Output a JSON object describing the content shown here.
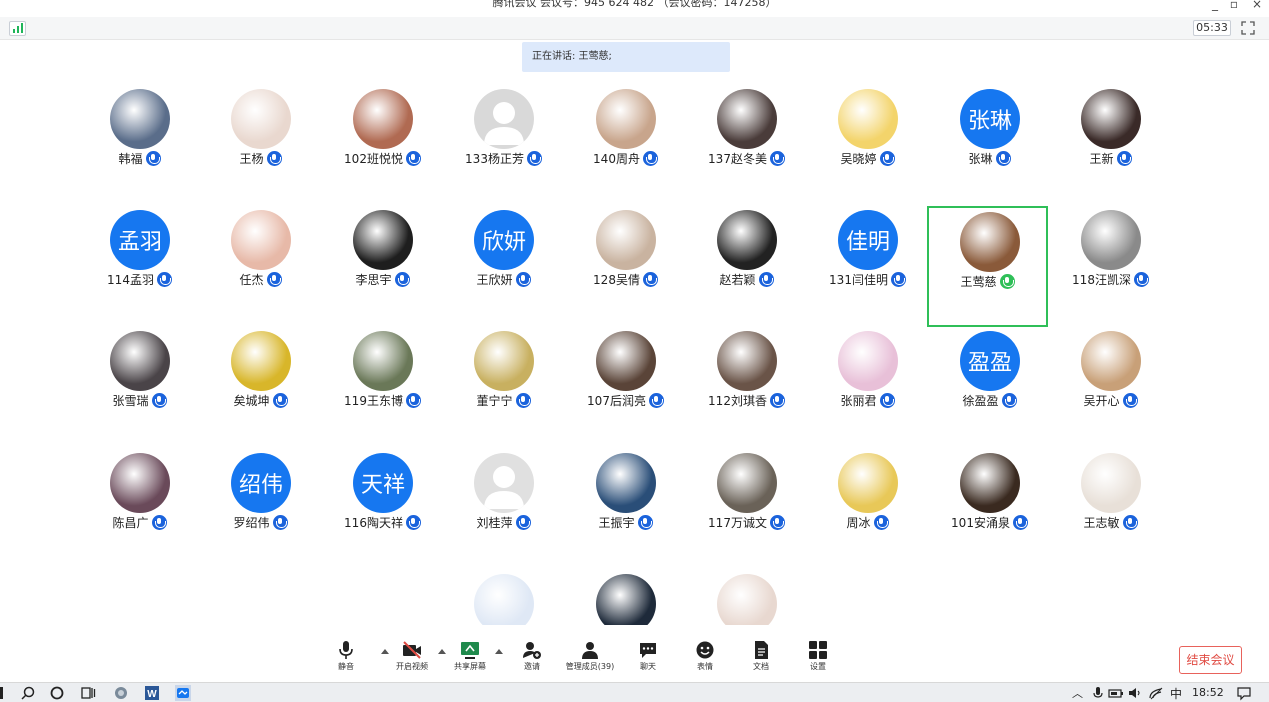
{
  "window": {
    "title": "腾讯会议 会议号：945 624 482 （会议密码：147258）",
    "timer": "05:33"
  },
  "speaking": "正在讲话: 王莺慈;",
  "participants": [
    {
      "name": "韩福",
      "avatar": "photo",
      "color": "#5a6d8a"
    },
    {
      "name": "王杨",
      "avatar": "photo",
      "color": "#e9d8cf"
    },
    {
      "name": "102班悦悦",
      "avatar": "photo",
      "color": "#b06a52"
    },
    {
      "name": "133杨正芳",
      "avatar": "gray",
      "color": "#d9d9d9"
    },
    {
      "name": "140周舟",
      "avatar": "photo",
      "color": "#c8a58c"
    },
    {
      "name": "137赵冬美",
      "avatar": "photo",
      "color": "#4a3c3a"
    },
    {
      "name": "吴晓婷",
      "avatar": "photo",
      "color": "#f3d46b"
    },
    {
      "name": "张琳",
      "avatar": "blue",
      "text": "张琳"
    },
    {
      "name": "王新",
      "avatar": "photo",
      "color": "#3a2a28"
    },
    {
      "name": "114孟羽",
      "avatar": "blue",
      "text": "孟羽"
    },
    {
      "name": "任杰",
      "avatar": "photo",
      "color": "#e7b9a8"
    },
    {
      "name": "李思宇",
      "avatar": "photo",
      "color": "#1e1e1e"
    },
    {
      "name": "王欣妍",
      "avatar": "blue",
      "text": "欣妍"
    },
    {
      "name": "128吴倩",
      "avatar": "photo",
      "color": "#c9b3a0"
    },
    {
      "name": "赵若颖",
      "avatar": "photo",
      "color": "#222"
    },
    {
      "name": "131闫佳明",
      "avatar": "blue",
      "text": "佳明"
    },
    {
      "name": "王莺慈",
      "avatar": "photo",
      "color": "#8a5a3a",
      "active": true
    },
    {
      "name": "118汪凯深",
      "avatar": "photo",
      "color": "#8a8a8a"
    },
    {
      "name": "张雪瑞",
      "avatar": "photo",
      "color": "#4a4448"
    },
    {
      "name": "矣城坤",
      "avatar": "photo",
      "color": "#d8b62a"
    },
    {
      "name": "119王东博",
      "avatar": "photo",
      "color": "#6a7858"
    },
    {
      "name": "董宁宁",
      "avatar": "photo",
      "color": "#c8b060"
    },
    {
      "name": "107后润亮",
      "avatar": "photo",
      "color": "#5a4438"
    },
    {
      "name": "112刘琪香",
      "avatar": "photo",
      "color": "#6a5448"
    },
    {
      "name": "张丽君",
      "avatar": "photo",
      "color": "#e8c0d8"
    },
    {
      "name": "徐盈盈",
      "avatar": "blue",
      "text": "盈盈"
    },
    {
      "name": "吴开心",
      "avatar": "photo",
      "color": "#c8a078"
    },
    {
      "name": "陈昌广",
      "avatar": "photo",
      "color": "#6a4a5a"
    },
    {
      "name": "罗绍伟",
      "avatar": "blue",
      "text": "绍伟"
    },
    {
      "name": "116陶天祥",
      "avatar": "blue",
      "text": "天祥"
    },
    {
      "name": "刘桂萍",
      "avatar": "gray",
      "color": "#e0e0e0"
    },
    {
      "name": "王振宇",
      "avatar": "photo",
      "color": "#2a4e78"
    },
    {
      "name": "117万诚文",
      "avatar": "photo",
      "color": "#6a6258"
    },
    {
      "name": "周冰",
      "avatar": "photo",
      "color": "#e8c858"
    },
    {
      "name": "101安涌泉",
      "avatar": "photo",
      "color": "#3a2a20"
    },
    {
      "name": "王志敏",
      "avatar": "photo",
      "color": "#e8e0d8"
    },
    {
      "name": "",
      "avatar": "photo",
      "color": "#dfe8f5"
    },
    {
      "name": "",
      "avatar": "photo",
      "color": "#1e2a3a"
    },
    {
      "name": "",
      "avatar": "photo",
      "color": "#e8d8d0"
    }
  ],
  "toolbar": {
    "mute": "静音",
    "video": "开启视频",
    "share": "共享屏幕",
    "invite": "邀请",
    "members": "管理成员(39)",
    "chat": "聊天",
    "emoji": "表情",
    "docs": "文档",
    "settings": "设置",
    "end": "结束会议"
  },
  "taskbar": {
    "ime": "中",
    "clock": "18:52"
  }
}
